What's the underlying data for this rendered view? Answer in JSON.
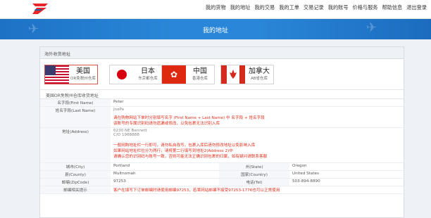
{
  "nav": [
    "我的货物",
    "我的地址",
    "我的交易",
    "我的工单",
    "交易记录",
    "我的账号",
    "价格与服务",
    "帮助信息",
    "退出登录"
  ],
  "banner": {
    "title": "我的地址"
  },
  "section_title": "海外收货地址",
  "warehouses": [
    {
      "name": "美国",
      "sub": "OR免税州仓库",
      "flag": "us",
      "selected": true
    },
    {
      "name": "日本",
      "sub": "东京都仓库",
      "flag": "jp",
      "selected": false
    },
    {
      "name": "中国",
      "sub": "香港仓库",
      "flag": "hk",
      "selected": false
    },
    {
      "name": "加拿大",
      "sub": "AB省仓库",
      "flag": "ca",
      "selected": false
    }
  ],
  "address_head": "美国OR免税州仓库收货地址",
  "fields": {
    "first_name": {
      "label": "名字段(First Name)",
      "value": "Peter"
    },
    "last_name": {
      "label": "姓名字段(Last Name)",
      "value": "JnePe",
      "note1": "请在购物网站下单时分别填写名字 (First Name + Last Name) 中 名字段 + 姓名字段",
      "note2": "该账号的专属识别码请勿遗漏或修改，以免包裹无法识别入库"
    },
    "address": {
      "label": "地址(Address)",
      "value1": "6230 NE Bennett",
      "value2": "C/O 1968888",
      "note1": "一般网购地址栏一行即可，请勿私自改写。包裹入库后请勿修改地址以免影响入库",
      "note2": "如果网站地址栏位分为两行，请将第二行填写到地址2(Address 2)中",
      "note3": "请确认您的识别码与账号一致，否则可能无法正确识别包裹的归属，如有疑问请联系客服"
    },
    "city": {
      "label": "城市(City)",
      "value": "Portland"
    },
    "state": {
      "label": "州(State)",
      "value": "Oregon"
    },
    "county": {
      "label": "县(County)",
      "value": "Multnomah"
    },
    "country": {
      "label": "国家(Country)",
      "value": "United States"
    },
    "zip": {
      "label": "邮编(ZipCode)",
      "value": "97253"
    },
    "tel": {
      "label": "电话(Tel)",
      "value": "503-894-8890"
    },
    "zip_hint": {
      "label": "邮编相关提示",
      "value": "客户在填写下订单邮编时请使用邮编97253，若某网站邮编不接受97253-1776也可以正常使用"
    }
  },
  "colors": {
    "banner": "#2a86d8",
    "accent_red": "#e0301e"
  }
}
